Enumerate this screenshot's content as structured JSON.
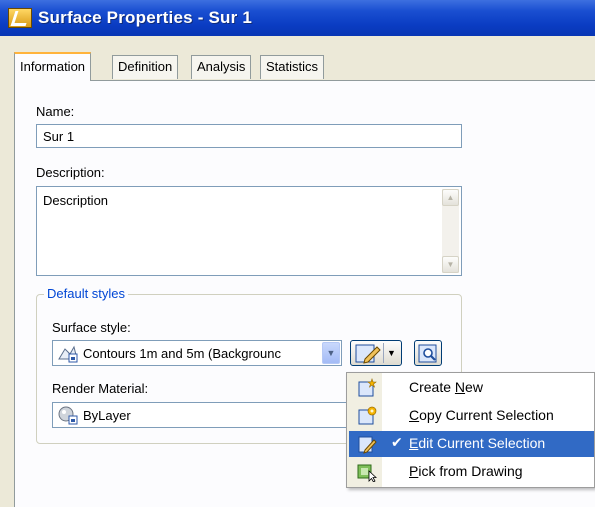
{
  "window": {
    "title": "Surface Properties - Sur 1"
  },
  "tabs": [
    {
      "label": "Information",
      "active": true
    },
    {
      "label": "Definition",
      "active": false
    },
    {
      "label": "Analysis",
      "active": false
    },
    {
      "label": "Statistics",
      "active": false
    }
  ],
  "form": {
    "name_label": "Name:",
    "name_value": "Sur 1",
    "description_label": "Description:",
    "description_value": "Description"
  },
  "default_styles": {
    "group_title": "Default styles",
    "surface_style_label": "Surface style:",
    "surface_style_value": "Contours 1m and 5m (Backgrounc",
    "render_material_label": "Render Material:",
    "render_material_value": "ByLayer"
  },
  "context_menu": {
    "items": [
      {
        "prefix": "Create ",
        "accel": "N",
        "suffix": "ew",
        "icon": "create-style-icon",
        "highlighted": false,
        "checked": false
      },
      {
        "prefix": "",
        "accel": "C",
        "suffix": "opy Current Selection",
        "icon": "copy-style-icon",
        "highlighted": false,
        "checked": false
      },
      {
        "prefix": "",
        "accel": "E",
        "suffix": "dit Current Selection",
        "icon": "edit-style-icon",
        "highlighted": true,
        "checked": true
      },
      {
        "prefix": "",
        "accel": "P",
        "suffix": "ick from Drawing",
        "icon": "pick-from-drawing-icon",
        "highlighted": false,
        "checked": false
      }
    ]
  },
  "colors": {
    "title_bar": "#0a3cc2",
    "menu_highlight": "#316ac5",
    "group_title": "#0046d5",
    "active_tab_accent": "#ffb33b"
  }
}
